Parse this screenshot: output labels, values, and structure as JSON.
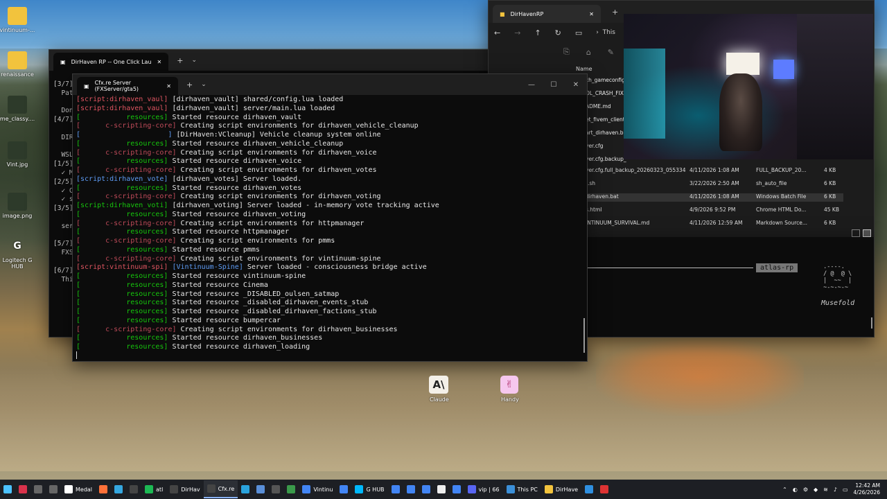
{
  "desktop": {
    "icons": [
      {
        "label": "vintinuum-...",
        "icon": "folder-icon"
      },
      {
        "label": "renaissance",
        "icon": "folder-icon"
      },
      {
        "label": "me_classy....",
        "icon": "image-icon"
      },
      {
        "label": "Vint.jpg",
        "icon": "image-icon"
      },
      {
        "label": "image.png",
        "icon": "image-icon"
      },
      {
        "label": "Logitech G HUB",
        "icon": "logitech-icon"
      }
    ],
    "floating": [
      {
        "label": "Claude",
        "icon": "claude-icon"
      },
      {
        "label": "Handy",
        "icon": "handy-icon"
      }
    ]
  },
  "back_terminal": {
    "tab_title": "DirHaven RP -- One Click Lau",
    "lines": [
      "[3/7]",
      "  Pat",
      "",
      "  Don",
      "[4/7]",
      "",
      "  DIR",
      "",
      "  WSL",
      "[1/5]",
      "  ✓ M",
      "[2/5]",
      "  ✓ C",
      "  ✓ s",
      "[3/5]",
      "",
      "  ser",
      "",
      "[5/7]",
      "  FXS",
      "",
      "[6/7]",
      "  Thi"
    ]
  },
  "front_terminal": {
    "tab_title": "Cfx.re Server (FXServer/gta5)",
    "log": [
      [
        {
          "t": "[script:dirhaven_vaul] ",
          "c": "red"
        },
        {
          "t": "[dirhaven_vault] shared/config.lua loaded",
          "c": "white"
        }
      ],
      [
        {
          "t": "[script:dirhaven_vaul] ",
          "c": "red"
        },
        {
          "t": "[dirhaven_vault] server/main.lua loaded",
          "c": "white"
        }
      ],
      [
        {
          "t": "[           resources] ",
          "c": "green"
        },
        {
          "t": "Started resource dirhaven_vault",
          "c": "white"
        }
      ],
      [
        {
          "t": "[      c-scripting-core] ",
          "c": "mag"
        },
        {
          "t": "Creating script environments for dirhaven_vehicle_cleanup",
          "c": "white"
        }
      ],
      [
        {
          "t": "[                     ] ",
          "c": "blue"
        },
        {
          "t": "[DirHaven:VCleanup] Vehicle cleanup system online",
          "c": "white"
        }
      ],
      [
        {
          "t": "[           resources] ",
          "c": "green"
        },
        {
          "t": "Started resource dirhaven_vehicle_cleanup",
          "c": "white"
        }
      ],
      [
        {
          "t": "[      c-scripting-core] ",
          "c": "mag"
        },
        {
          "t": "Creating script environments for dirhaven_voice",
          "c": "white"
        }
      ],
      [
        {
          "t": "[           resources] ",
          "c": "green"
        },
        {
          "t": "Started resource dirhaven_voice",
          "c": "white"
        }
      ],
      [
        {
          "t": "[      c-scripting-core] ",
          "c": "mag"
        },
        {
          "t": "Creating script environments for dirhaven_votes",
          "c": "white"
        }
      ],
      [
        {
          "t": "[script:dirhaven_vote] ",
          "c": "blue"
        },
        {
          "t": "[dirhaven_votes] Server loaded.",
          "c": "white"
        }
      ],
      [
        {
          "t": "[           resources] ",
          "c": "green"
        },
        {
          "t": "Started resource dirhaven_votes",
          "c": "white"
        }
      ],
      [
        {
          "t": "[      c-scripting-core] ",
          "c": "mag"
        },
        {
          "t": "Creating script environments for dirhaven_voting",
          "c": "white"
        }
      ],
      [
        {
          "t": "[script:dirhaven_voti] ",
          "c": "green"
        },
        {
          "t": "[dirhaven_voting] Server loaded - in-memory vote tracking active",
          "c": "white"
        }
      ],
      [
        {
          "t": "[           resources] ",
          "c": "green"
        },
        {
          "t": "Started resource dirhaven_voting",
          "c": "white"
        }
      ],
      [
        {
          "t": "[      c-scripting-core] ",
          "c": "mag"
        },
        {
          "t": "Creating script environments for httpmanager",
          "c": "white"
        }
      ],
      [
        {
          "t": "[           resources] ",
          "c": "green"
        },
        {
          "t": "Started resource httpmanager",
          "c": "white"
        }
      ],
      [
        {
          "t": "[      c-scripting-core] ",
          "c": "mag"
        },
        {
          "t": "Creating script environments for pmms",
          "c": "white"
        }
      ],
      [
        {
          "t": "[           resources] ",
          "c": "green"
        },
        {
          "t": "Started resource pmms",
          "c": "white"
        }
      ],
      [
        {
          "t": "[      c-scripting-core] ",
          "c": "mag"
        },
        {
          "t": "Creating script environments for vintinuum-spine",
          "c": "white"
        }
      ],
      [
        {
          "t": "[script:vintinuum-spi] ",
          "c": "red"
        },
        {
          "t": "[Vintinuum-Spine] ",
          "c": "blue"
        },
        {
          "t": "Server loaded - consciousness bridge active",
          "c": "white"
        }
      ],
      [
        {
          "t": "[           resources] ",
          "c": "green"
        },
        {
          "t": "Started resource vintinuum-spine",
          "c": "white"
        }
      ],
      [
        {
          "t": "[           resources] ",
          "c": "green"
        },
        {
          "t": "Started resource Cinema",
          "c": "white"
        }
      ],
      [
        {
          "t": "[           resources] ",
          "c": "green"
        },
        {
          "t": "Started resource _DISABLED_oulsen_satmap",
          "c": "white"
        }
      ],
      [
        {
          "t": "[           resources] ",
          "c": "green"
        },
        {
          "t": "Started resource _disabled_dirhaven_events_stub",
          "c": "white"
        }
      ],
      [
        {
          "t": "[           resources] ",
          "c": "green"
        },
        {
          "t": "Started resource _disabled_dirhaven_factions_stub",
          "c": "white"
        }
      ],
      [
        {
          "t": "[           resources] ",
          "c": "green"
        },
        {
          "t": "Started resource bumpercar",
          "c": "white"
        }
      ],
      [
        {
          "t": "[      c-scripting-core] ",
          "c": "mag"
        },
        {
          "t": "Creating script environments for dirhaven_businesses",
          "c": "white"
        }
      ],
      [
        {
          "t": "[           resources] ",
          "c": "green"
        },
        {
          "t": "Started resource dirhaven_businesses",
          "c": "white"
        }
      ],
      [
        {
          "t": "[           resources] ",
          "c": "green"
        },
        {
          "t": "Started resource dirhaven_loading",
          "c": "white"
        }
      ]
    ]
  },
  "explorer": {
    "tab_title": "DirHavenRP",
    "address": "This",
    "column_name": "Name",
    "partial_names": [
      "ch_gameconfig",
      "OL_CRASH_FIX",
      "ADME.md",
      "et_fivem_client",
      "art_dirhaven.ba",
      "ver.cfg",
      "ver.cfg.backup_"
    ],
    "rows": [
      {
        "name": "ver.cfg.full_backup_20260323_055334",
        "date": "4/11/2026 1:08 AM",
        "type": "FULL_BACKUP_20...",
        "size": "4 KB"
      },
      {
        "name": "t.sh",
        "date": "3/22/2026 2:50 AM",
        "type": "sh_auto_file",
        "size": "6 KB"
      },
      {
        "name": "dirhaven.bat",
        "date": "4/11/2026 1:08 AM",
        "type": "Windows Batch File",
        "size": "6 KB"
      },
      {
        "name": "s.html",
        "date": "4/9/2026 9:52 PM",
        "type": "Chrome HTML Do...",
        "size": "45 KB"
      },
      {
        "name": "INTINUUM_SURVIVAL.md",
        "date": "4/11/2026 12:59 AM",
        "type": "Markdown Source...",
        "size": "6 KB"
      }
    ]
  },
  "console3": {
    "tag": "atlas-rp",
    "ascii": " .----.\n / @  @ \\\n |  ~~  |\n ~-~-~-~",
    "caption": "Musefold"
  },
  "taskbar": {
    "items": [
      {
        "label": "",
        "icon": "windows-icon"
      },
      {
        "label": "",
        "icon": "app-a-icon"
      },
      {
        "label": "",
        "icon": "search-icon"
      },
      {
        "label": "",
        "icon": "taskview-icon"
      },
      {
        "label": "Medal",
        "icon": "medal-icon"
      },
      {
        "label": "",
        "icon": "firefox-icon"
      },
      {
        "label": "",
        "icon": "edge-icon"
      },
      {
        "label": "",
        "icon": "terminal-icon"
      },
      {
        "label": "atl",
        "icon": "app-green-icon"
      },
      {
        "label": "DirHav",
        "icon": "terminal-icon"
      },
      {
        "label": "Cfx.re",
        "icon": "terminal-icon"
      },
      {
        "label": "",
        "icon": "telegram-icon"
      },
      {
        "label": "",
        "icon": "edit-icon"
      },
      {
        "label": "",
        "icon": "video-icon"
      },
      {
        "label": "",
        "icon": "app-icon"
      },
      {
        "label": "Vintinu",
        "icon": "chrome-icon"
      },
      {
        "label": "",
        "icon": "chrome-icon"
      },
      {
        "label": "G HUB",
        "icon": "ghub-icon"
      },
      {
        "label": "",
        "icon": "chrome-icon"
      },
      {
        "label": "",
        "icon": "chrome-icon"
      },
      {
        "label": "",
        "icon": "chrome-icon"
      },
      {
        "label": "",
        "icon": "github-icon"
      },
      {
        "label": "",
        "icon": "chrome-icon"
      },
      {
        "label": "vip | 66",
        "icon": "discord-icon"
      },
      {
        "label": "This PC",
        "icon": "computer-icon"
      },
      {
        "label": "DirHave",
        "icon": "folder-icon"
      },
      {
        "label": "",
        "icon": "vscode-icon"
      },
      {
        "label": "",
        "icon": "app-red-icon"
      }
    ],
    "time": "12:42 AM",
    "date": "4/26/2026"
  },
  "colors": {
    "red": "#e05561",
    "green": "#16c60c",
    "blue": "#5e9cf5",
    "white": "#e8e8e8",
    "magenta": "#c04b5a",
    "taskbar_bg": "#1d1f24",
    "terminal_bg": "#0c0c0c"
  }
}
